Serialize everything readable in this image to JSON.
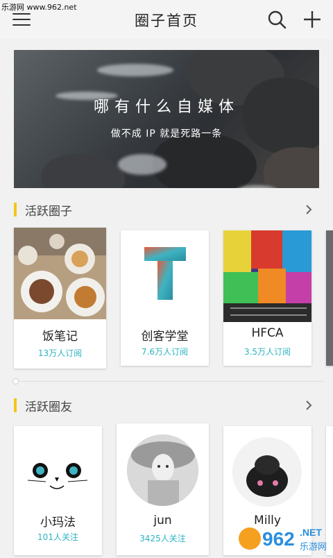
{
  "watermark_top": "乐游网 www.962.net",
  "header": {
    "title": "圈子首页"
  },
  "banner": {
    "title": "哪有什么自媒体",
    "subtitle": "做不成 IP 就是死路一条"
  },
  "active_circles": {
    "title": "活跃圈子",
    "items": [
      {
        "name": "饭笔记",
        "subscribers": "13万人订阅"
      },
      {
        "name": "创客学堂",
        "subscribers": "7.6万人订阅"
      },
      {
        "name": "HFCA",
        "subscribers": "3.5万人订阅"
      }
    ]
  },
  "active_friends": {
    "title": "活跃圈友",
    "items": [
      {
        "name": "小玛法",
        "followers": "101人关注"
      },
      {
        "name": "jun",
        "followers": "3425人关注"
      },
      {
        "name": "Milly",
        "followers": ""
      }
    ]
  },
  "watermark_bottom": {
    "brand": "962",
    "suffix": ".NET",
    "tag": "乐游网"
  },
  "colors": {
    "accent": "#f5c518",
    "teal": "#2bb3c0",
    "background": "#f1f1f1"
  }
}
